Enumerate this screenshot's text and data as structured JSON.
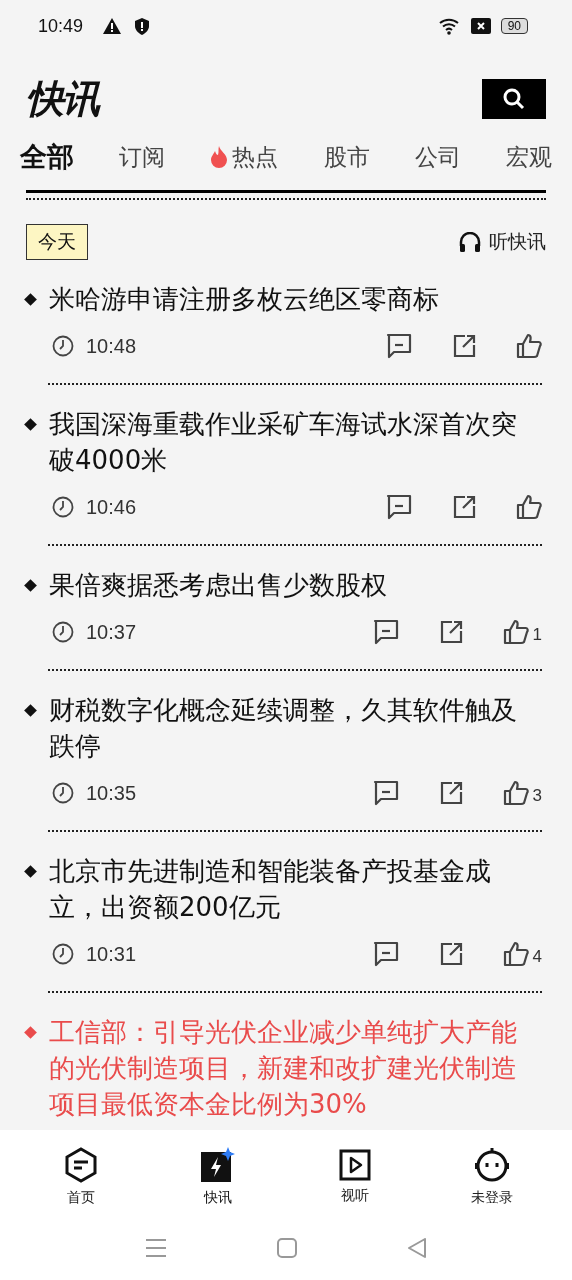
{
  "status_bar": {
    "time": "10:49",
    "battery": "90"
  },
  "header": {
    "logo": "快讯"
  },
  "tabs": [
    {
      "label": "全部",
      "selected": true,
      "hot": false
    },
    {
      "label": "订阅",
      "selected": false,
      "hot": false
    },
    {
      "label": "热点",
      "selected": false,
      "hot": true
    },
    {
      "label": "股市",
      "selected": false,
      "hot": false
    },
    {
      "label": "公司",
      "selected": false,
      "hot": false
    },
    {
      "label": "宏观",
      "selected": false,
      "hot": false
    }
  ],
  "date_badge": "今天",
  "listen_button": "听快讯",
  "news": [
    {
      "title": "米哈游申请注册多枚云绝区零商标",
      "time": "10:48",
      "highlight": false
    },
    {
      "title": "我国深海重载作业采矿车海试水深首次突破4000米",
      "time": "10:46",
      "highlight": false
    },
    {
      "title": "果倍爽据悉考虑出售少数股权",
      "time": "10:37",
      "likes": "1",
      "highlight": false
    },
    {
      "title": "财税数字化概念延续调整，久其软件触及跌停",
      "time": "10:35",
      "likes": "3",
      "highlight": false
    },
    {
      "title": "北京市先进制造和智能装备产投基金成立，出资额200亿元",
      "time": "10:31",
      "likes": "4",
      "highlight": false
    },
    {
      "title": "工信部：引导光伏企业减少单纯扩大产能的光伏制造项目，新建和改扩建光伏制造项目最低资本金比例为30%",
      "highlight": true
    }
  ],
  "bottom_nav": [
    {
      "label": "首页",
      "kind": "home",
      "selected": false
    },
    {
      "label": "快讯",
      "kind": "flash",
      "selected": true
    },
    {
      "label": "视听",
      "kind": "video",
      "selected": false
    },
    {
      "label": "未登录",
      "kind": "profile",
      "selected": false
    }
  ]
}
